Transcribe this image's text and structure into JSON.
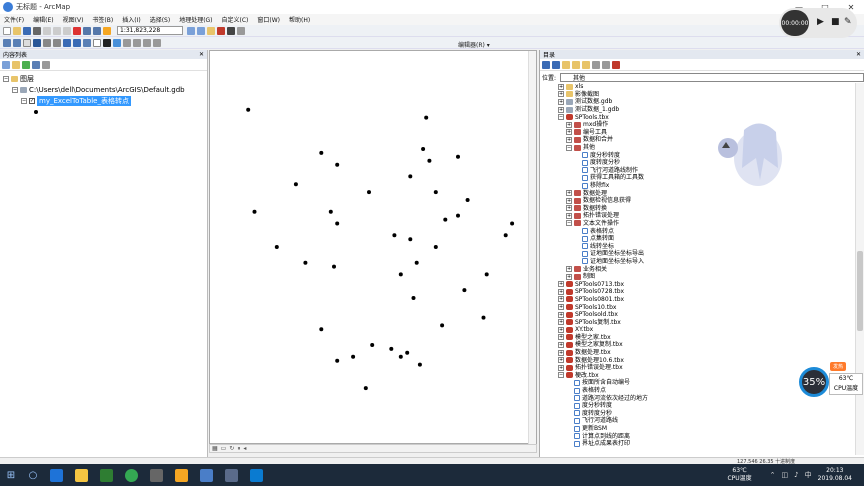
{
  "window": {
    "title": "无标题 - ArcMap",
    "controls": [
      "—",
      "□",
      "✕"
    ]
  },
  "menu": [
    "文件(F)",
    "编辑(E)",
    "视图(V)",
    "书签(B)",
    "插入(I)",
    "选择(S)",
    "地理处理(G)",
    "自定义(C)",
    "窗口(W)",
    "帮助(H)"
  ],
  "toolbar": {
    "scale": "1:31,823,228",
    "editor_label": "编辑器(R) ▾"
  },
  "toc": {
    "header": "内容列表",
    "root_label": "图层",
    "db_path": "C:\\Users\\dell\\Documents\\ArcGIS\\Default.gdb",
    "layer": "my_ExcelToTable_表格转点"
  },
  "catalog": {
    "header": "目录",
    "location_label": "位置:",
    "location_value": "其他",
    "items": [
      {
        "d": 1,
        "t": "xls",
        "i": "folder"
      },
      {
        "d": 1,
        "t": "影像截图",
        "i": "folder"
      },
      {
        "d": 1,
        "t": "测试数据.gdb",
        "i": "db"
      },
      {
        "d": 1,
        "t": "测试数据_1.gdb",
        "i": "db"
      },
      {
        "d": 1,
        "t": "SPTools.tbx",
        "i": "tbx"
      },
      {
        "d": 2,
        "t": "mxd操作",
        "i": "set"
      },
      {
        "d": 2,
        "t": "编号工具",
        "i": "set"
      },
      {
        "d": 2,
        "t": "数据和合并",
        "i": "set"
      },
      {
        "d": 2,
        "t": "其他",
        "i": "set"
      },
      {
        "d": 3,
        "t": "度分秒转度",
        "i": "tool"
      },
      {
        "d": 3,
        "t": "度转度分秒",
        "i": "tool"
      },
      {
        "d": 3,
        "t": "飞行河道路线制作",
        "i": "tool"
      },
      {
        "d": 3,
        "t": "获得工具箱的工具数",
        "i": "tool"
      },
      {
        "d": 3,
        "t": "移除fix",
        "i": "tool"
      },
      {
        "d": 2,
        "t": "数据处理",
        "i": "set"
      },
      {
        "d": 2,
        "t": "数据检视信息获得",
        "i": "set"
      },
      {
        "d": 2,
        "t": "数据转换",
        "i": "set"
      },
      {
        "d": 2,
        "t": "拓扑错误处理",
        "i": "set"
      },
      {
        "d": 2,
        "t": "文本文件操作",
        "i": "set"
      },
      {
        "d": 3,
        "t": "表格转点",
        "i": "tool"
      },
      {
        "d": 3,
        "t": "点集转面",
        "i": "tool"
      },
      {
        "d": 3,
        "t": "线转坐标",
        "i": "tool"
      },
      {
        "d": 3,
        "t": "证地面坐标坐标导出",
        "i": "tool"
      },
      {
        "d": 3,
        "t": "证地面坐标坐标导入",
        "i": "tool"
      },
      {
        "d": 2,
        "t": "业务相关",
        "i": "set"
      },
      {
        "d": 2,
        "t": "制图",
        "i": "set"
      },
      {
        "d": 1,
        "t": "SPTools0713.tbx",
        "i": "tbx"
      },
      {
        "d": 1,
        "t": "SPTools0728.tbx",
        "i": "tbx"
      },
      {
        "d": 1,
        "t": "SPTools0801.tbx",
        "i": "tbx"
      },
      {
        "d": 1,
        "t": "SPTools10.tbx",
        "i": "tbx"
      },
      {
        "d": 1,
        "t": "SPToolsold.tbx",
        "i": "tbx"
      },
      {
        "d": 1,
        "t": "SPTools复制.tbx",
        "i": "tbx"
      },
      {
        "d": 1,
        "t": "XY.tbx",
        "i": "tbx"
      },
      {
        "d": 1,
        "t": "模型之家.tbx",
        "i": "tbx"
      },
      {
        "d": 1,
        "t": "模型之家复制.tbx",
        "i": "tbx"
      },
      {
        "d": 1,
        "t": "数据处理.tbx",
        "i": "tbx"
      },
      {
        "d": 1,
        "t": "数据处理10.6.tbx",
        "i": "tbx"
      },
      {
        "d": 1,
        "t": "拓扑错误处理.tbx",
        "i": "tbx"
      },
      {
        "d": 1,
        "t": "梗改.tbx",
        "i": "tbx"
      },
      {
        "d": 2,
        "t": "按面所含自动编号",
        "i": "tool"
      },
      {
        "d": 2,
        "t": "表格转点",
        "i": "tool"
      },
      {
        "d": 2,
        "t": "道路河流依次经过的地方",
        "i": "tool"
      },
      {
        "d": 2,
        "t": "度分秒转度",
        "i": "tool"
      },
      {
        "d": 2,
        "t": "度转度分秒",
        "i": "tool"
      },
      {
        "d": 2,
        "t": "飞行河道路线",
        "i": "tool"
      },
      {
        "d": 2,
        "t": "更新BSM",
        "i": "tool"
      },
      {
        "d": 2,
        "t": "计算点到线的距离",
        "i": "tool"
      },
      {
        "d": 2,
        "t": "界址点成果表打印",
        "i": "tool"
      }
    ]
  },
  "recorder": {
    "time": "00:00:00"
  },
  "cpu": {
    "percent": "35%",
    "temp": "63℃",
    "label": "CPU温度",
    "badge": "发热"
  },
  "status": {
    "coords": "127.546  26.35 十进制度"
  },
  "taskbar": {
    "temp": "63℃",
    "temp_label": "CPU温度",
    "time": "20:13",
    "date": "2019.08.04"
  },
  "map_points": [
    {
      "x": 14,
      "y": 41
    },
    {
      "x": 93,
      "y": 47
    },
    {
      "x": 95,
      "y": 44
    },
    {
      "x": 87,
      "y": 57
    },
    {
      "x": 86,
      "y": 68
    },
    {
      "x": 12,
      "y": 15
    },
    {
      "x": 21,
      "y": 50
    },
    {
      "x": 30,
      "y": 54
    },
    {
      "x": 38,
      "y": 41
    },
    {
      "x": 50,
      "y": 36
    },
    {
      "x": 60,
      "y": 57
    },
    {
      "x": 64,
      "y": 63
    },
    {
      "x": 65,
      "y": 54
    },
    {
      "x": 63,
      "y": 48
    },
    {
      "x": 71,
      "y": 50
    },
    {
      "x": 74,
      "y": 43
    },
    {
      "x": 78,
      "y": 42
    },
    {
      "x": 81,
      "y": 38
    },
    {
      "x": 73,
      "y": 70
    },
    {
      "x": 80,
      "y": 61
    },
    {
      "x": 69,
      "y": 28
    },
    {
      "x": 71,
      "y": 36
    },
    {
      "x": 78,
      "y": 27
    },
    {
      "x": 63,
      "y": 32
    },
    {
      "x": 67,
      "y": 25
    },
    {
      "x": 68,
      "y": 17
    },
    {
      "x": 58,
      "y": 47
    },
    {
      "x": 39,
      "y": 55
    },
    {
      "x": 40,
      "y": 29
    },
    {
      "x": 35,
      "y": 26
    },
    {
      "x": 27,
      "y": 34
    },
    {
      "x": 40,
      "y": 44
    },
    {
      "x": 40,
      "y": 79
    },
    {
      "x": 45,
      "y": 78
    },
    {
      "x": 51,
      "y": 75
    },
    {
      "x": 57,
      "y": 76
    },
    {
      "x": 60,
      "y": 78
    },
    {
      "x": 62,
      "y": 77
    },
    {
      "x": 35,
      "y": 71
    },
    {
      "x": 49,
      "y": 86
    },
    {
      "x": 66,
      "y": 80
    }
  ]
}
